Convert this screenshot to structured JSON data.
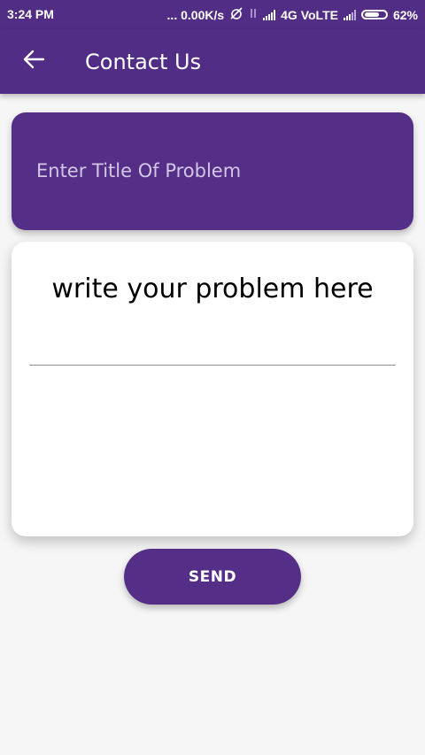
{
  "status_bar": {
    "time": "3:24 PM",
    "network_speed": "... 0.00K/s",
    "network_type": "4G VoLTE",
    "battery": "62%"
  },
  "app_bar": {
    "title": "Contact Us",
    "back_icon": "arrow-left-icon"
  },
  "form": {
    "title_placeholder": "Enter Title Of Problem",
    "problem_placeholder": "write your problem here",
    "send_label": "SEND"
  },
  "colors": {
    "primary": "#522d85",
    "background": "#f6f6f6",
    "card": "#ffffff"
  }
}
